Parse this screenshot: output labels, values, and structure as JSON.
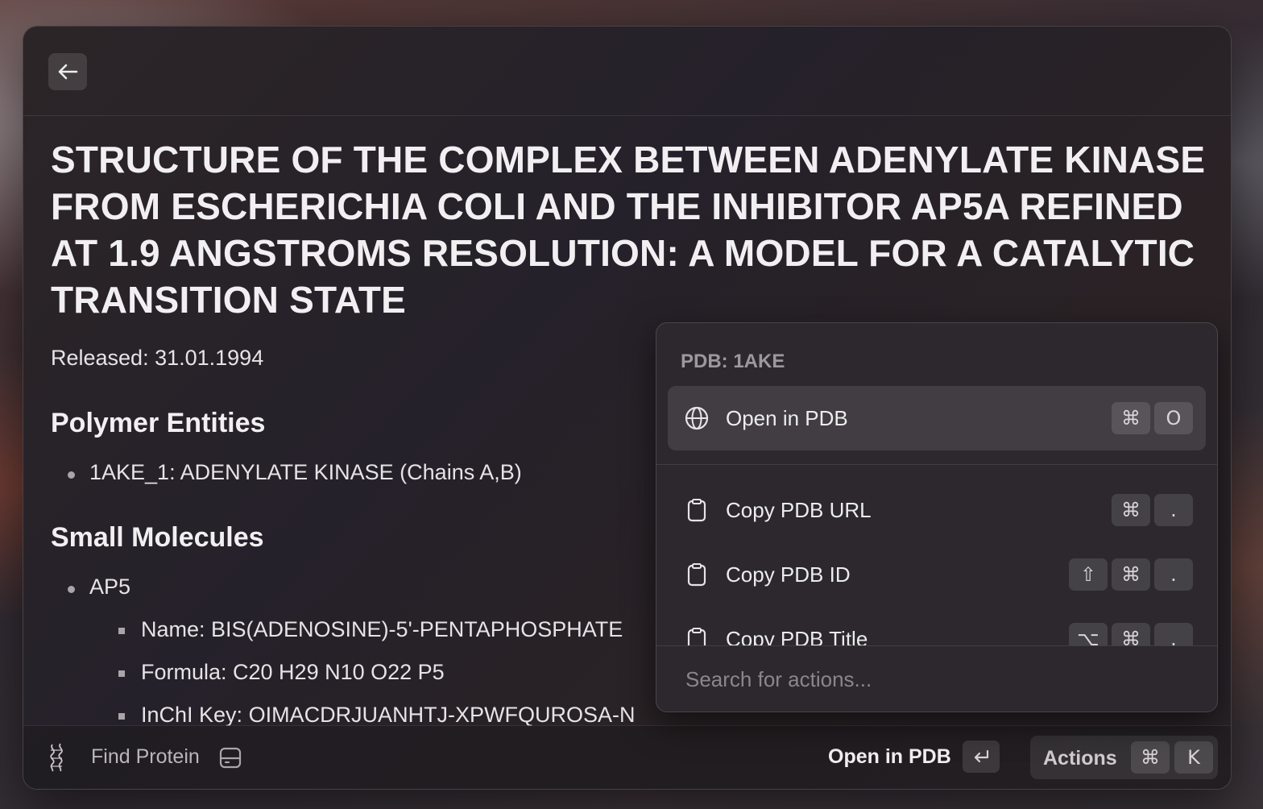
{
  "toolbar": {
    "back_icon": "arrow-left-icon"
  },
  "entry": {
    "title": "STRUCTURE OF THE COMPLEX BETWEEN ADENYLATE KINASE FROM ESCHERICHIA COLI AND THE INHIBITOR AP5A REFINED AT 1.9 ANGSTROMS RESOLUTION: A MODEL FOR A CATALYTIC TRANSITION STATE",
    "released": "Released: 31.01.1994",
    "polymer_heading": "Polymer Entities",
    "polymers": [
      "1AKE_1: ADENYLATE KINASE (Chains A,B)"
    ],
    "small_heading": "Small Molecules",
    "small_molecules": [
      {
        "name": "AP5",
        "details": [
          "Name: BIS(ADENOSINE)-5'-PENTAPHOSPHATE",
          "Formula: C20 H29 N10 O22 P5",
          "InChI Key: OIMACDRJUANHTJ-XPWFQUROSA-N"
        ]
      }
    ]
  },
  "actions_panel": {
    "title": "PDB: 1AKE",
    "items": [
      {
        "label": "Open in PDB",
        "icon": "globe-icon",
        "keys": [
          "⌘",
          "O"
        ],
        "selected": true
      },
      {
        "label": "Copy PDB URL",
        "icon": "clipboard-icon",
        "keys": [
          "⌘",
          "."
        ]
      },
      {
        "label": "Copy PDB ID",
        "icon": "clipboard-icon",
        "keys": [
          "⇧",
          "⌘",
          "."
        ]
      },
      {
        "label": "Copy PDB Title",
        "icon": "clipboard-icon",
        "keys": [
          "⌥",
          "⌘",
          "."
        ]
      }
    ],
    "search_placeholder": "Search for actions..."
  },
  "footer": {
    "extension_name": "Find Protein",
    "primary_action": "Open in PDB",
    "primary_key": "↵",
    "actions_label": "Actions",
    "actions_keys": [
      "⌘",
      "K"
    ]
  }
}
